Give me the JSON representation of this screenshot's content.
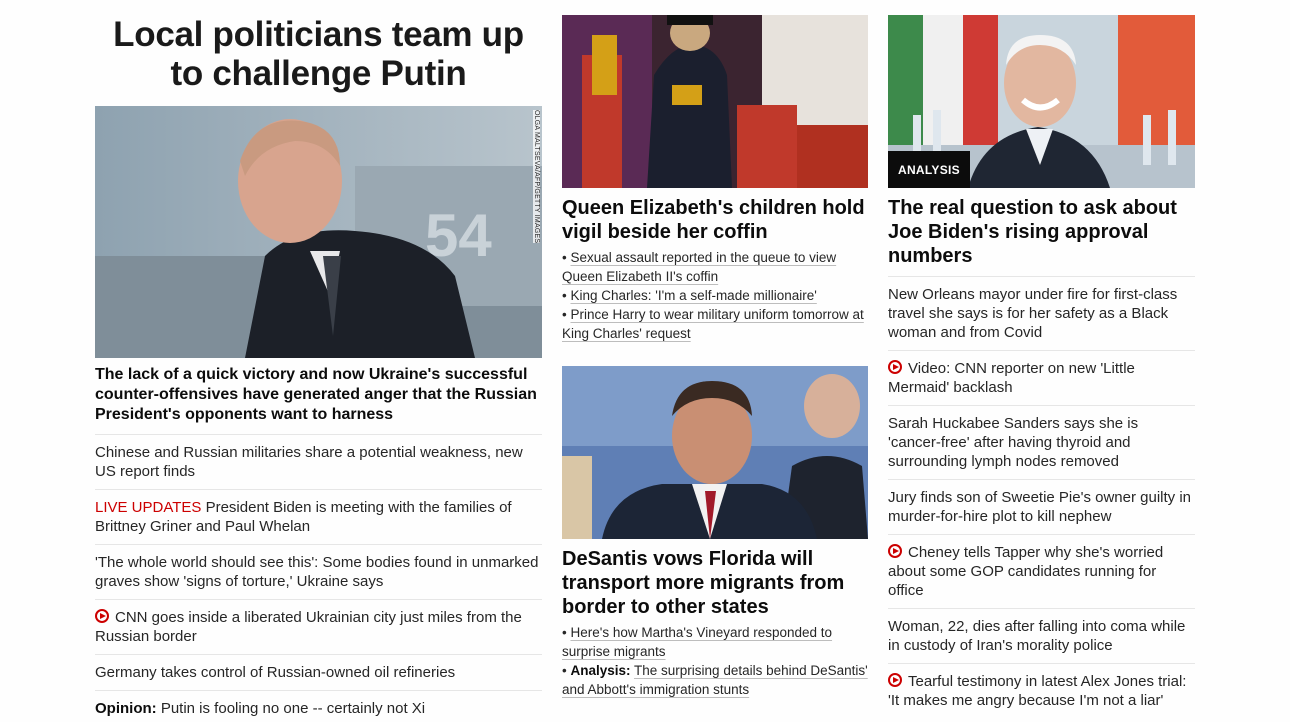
{
  "col1": {
    "headline": "Local politicians team up to challenge Putin",
    "image_credit": "OLGA MALTSEVA/AFP/GETTY IMAGES",
    "lead_desc": "The lack of a quick victory and now Ukraine's successful counter-offensives have generated anger that the Russian President's opponents want to harness",
    "items": [
      {
        "text": "Chinese and Russian militaries share a potential weakness, new US report finds"
      },
      {
        "prefix": "LIVE UPDATES",
        "text": "President Biden is meeting with the families of Brittney Griner and Paul Whelan"
      },
      {
        "text": "'The whole world should see this': Some bodies found in unmarked graves show 'signs of torture,' Ukraine says"
      },
      {
        "icon": "video-play-icon",
        "text": "CNN goes inside a liberated Ukrainian city just miles from the Russian border"
      },
      {
        "text": "Germany takes control of Russian-owned oil refineries"
      },
      {
        "label": "Opinion:",
        "text": "Putin is fooling no one -- certainly not Xi"
      }
    ]
  },
  "col2": {
    "story1": {
      "headline": "Queen Elizabeth's children hold vigil beside her coffin",
      "bullets": [
        "Sexual assault reported in the queue to view Queen Elizabeth II's coffin",
        "King Charles: 'I'm a self-made millionaire'",
        "Prince Harry to wear military uniform tomorrow at King Charles' request"
      ]
    },
    "story2": {
      "headline": "DeSantis vows Florida will transport more migrants from border to other states",
      "bullets": [
        {
          "text": "Here's how Martha's Vineyard responded to surprise migrants"
        },
        {
          "label": "Analysis:",
          "text": "The surprising details behind DeSantis' and Abbott's immigration stunts"
        }
      ]
    }
  },
  "col3": {
    "badge": "ANALYSIS",
    "headline": "The real question to ask about Joe Biden's rising approval numbers",
    "items": [
      {
        "text": "New Orleans mayor under fire for first-class travel she says is for her safety as a Black woman and from Covid"
      },
      {
        "icon": "video-play-icon",
        "text": "Video: CNN reporter on new 'Little Mermaid' backlash"
      },
      {
        "text": "Sarah Huckabee Sanders says she is 'cancer-free' after having thyroid and surrounding lymph nodes removed"
      },
      {
        "text": "Jury finds son of Sweetie Pie's owner guilty in murder-for-hire plot to kill nephew"
      },
      {
        "icon": "video-play-icon",
        "text": "Cheney tells Tapper why she's worried about some GOP candidates running for office"
      },
      {
        "text": "Woman, 22, dies after falling into coma while in custody of Iran's morality police"
      },
      {
        "icon": "video-play-icon",
        "text": "Tearful testimony in latest Alex Jones trial: 'It makes me angry because I'm not a liar'"
      }
    ]
  },
  "colors": {
    "live": "#cc0000",
    "badge_bg": "#0c0c0c",
    "divider": "#e6e6e6"
  }
}
